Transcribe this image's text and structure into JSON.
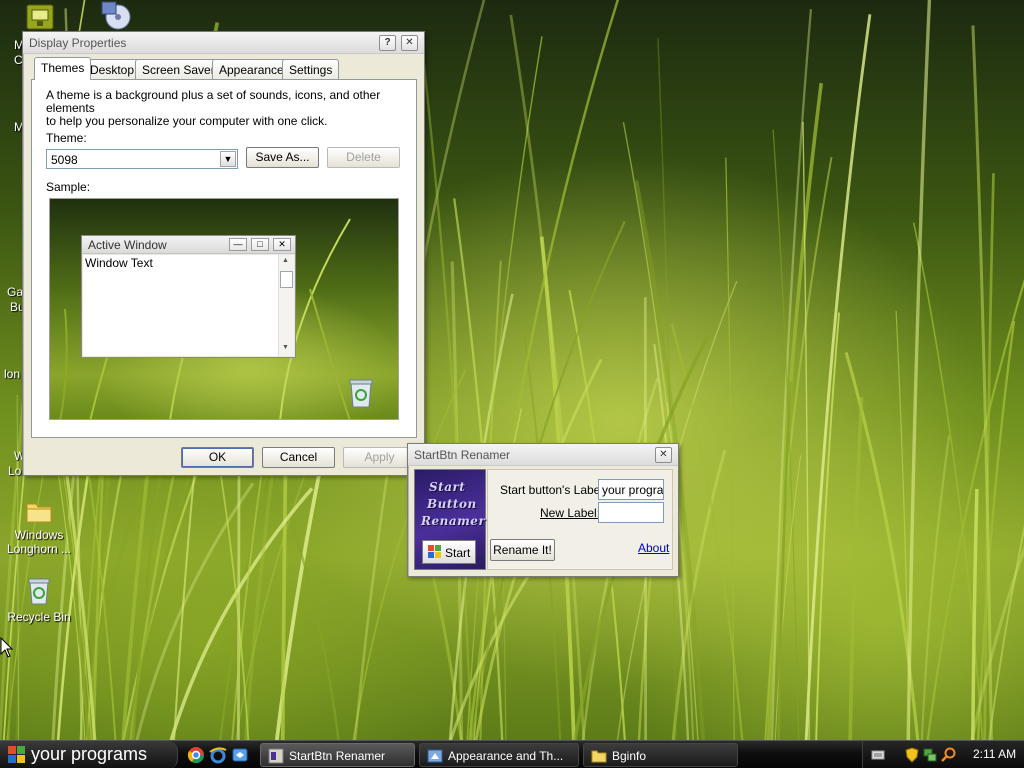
{
  "colors": {
    "window_face": "#ece9d8",
    "taskbar": "#0e0e0e",
    "link": "#0000cc",
    "renamer_art": "#4a2f9a"
  },
  "desktop": {
    "icons": [
      {
        "name": "folder-icon",
        "label_lines": [
          "Windows",
          "Longhorn ..."
        ]
      },
      {
        "name": "recycle-bin-icon",
        "label_lines": [
          "Recycle Bin"
        ]
      }
    ],
    "partial_labels": [
      "M",
      "C",
      "M",
      "Ga",
      "Bu",
      "lon",
      "W",
      "Lo"
    ]
  },
  "display_properties": {
    "title": "Display Properties",
    "help_btn": "?",
    "close_btn": "✕",
    "tabs": [
      "Themes",
      "Desktop",
      "Screen Saver",
      "Appearance",
      "Settings"
    ],
    "active_tab": "Themes",
    "description_1": "A theme is a background plus a set of sounds, icons, and other elements",
    "description_2": "to help you personalize your computer with one click.",
    "theme_label": "Theme:",
    "theme_value": "5098",
    "save_as": "Save As...",
    "delete": "Delete",
    "sample_label": "Sample:",
    "sample_window": {
      "title": "Active Window",
      "text": "Window Text",
      "min_glyph": "—",
      "max_glyph": "□",
      "close_glyph": "✕"
    },
    "ok": "OK",
    "cancel": "Cancel",
    "apply": "Apply"
  },
  "renamer": {
    "title": "StartBtn Renamer",
    "close_btn": "✕",
    "art_lines": [
      "Start",
      "Button",
      "Renamer"
    ],
    "start_preview": "Start",
    "current_label_caption": "Start button's Label:",
    "current_label_value": "your programs",
    "new_label_caption": "New Label:",
    "new_label_value": "",
    "rename_button": "Rename It!",
    "about_link": "About"
  },
  "taskbar": {
    "start_label": "your programs",
    "quicklaunch": [
      "chrome-icon",
      "ie-icon",
      "explorer-icon"
    ],
    "items": [
      {
        "label": "StartBtn Renamer",
        "active": true
      },
      {
        "label": "Appearance and Th...",
        "active": false
      },
      {
        "label": "Bginfo",
        "active": false
      }
    ],
    "clock": "2:11 AM"
  }
}
